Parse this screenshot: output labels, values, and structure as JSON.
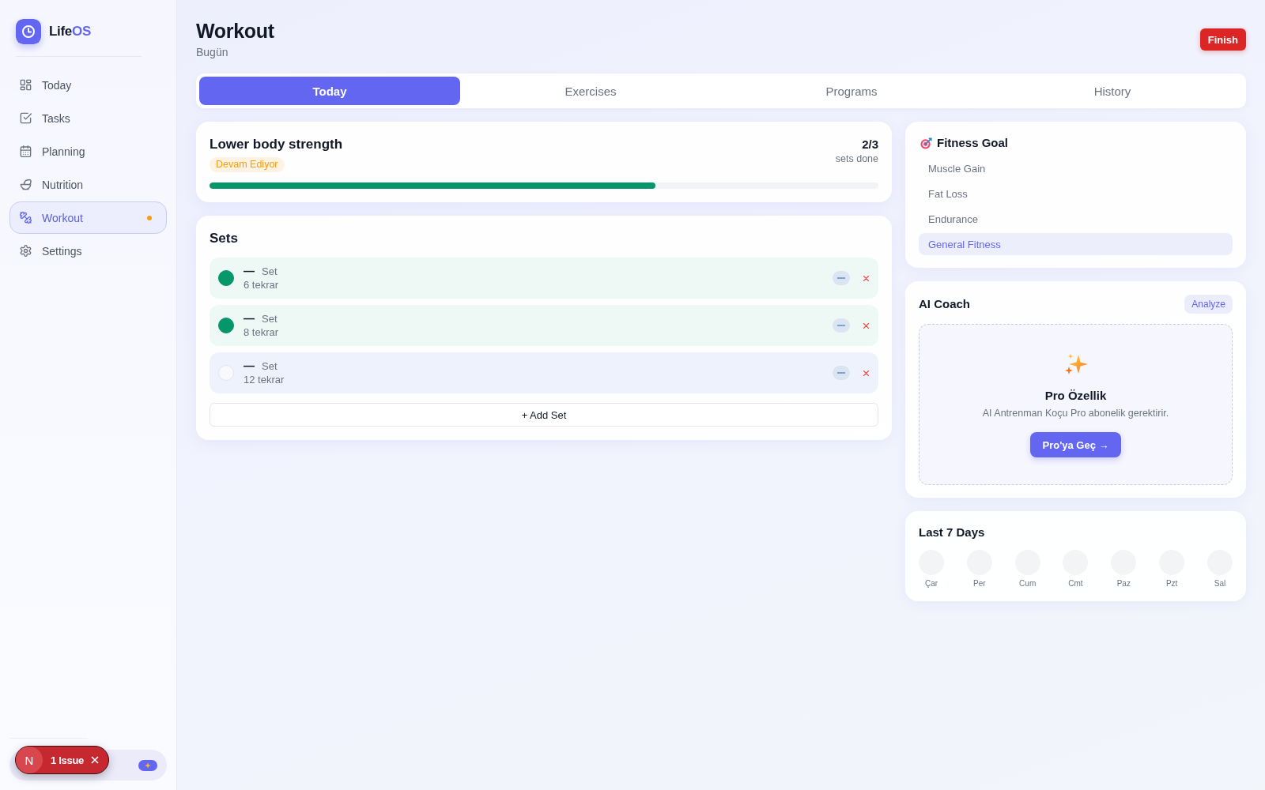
{
  "sidebar": {
    "brand": {
      "name": "Life",
      "accent": "OS"
    },
    "items": [
      {
        "label": "Today",
        "selected": false,
        "dot": false
      },
      {
        "label": "Tasks",
        "selected": false,
        "dot": false
      },
      {
        "label": "Planning",
        "selected": false,
        "dot": false
      },
      {
        "label": "Nutrition",
        "selected": false,
        "dot": false
      },
      {
        "label": "Workout",
        "selected": true,
        "dot": true
      },
      {
        "label": "Settings",
        "selected": false,
        "dot": false
      }
    ]
  },
  "header": {
    "title": "Workout",
    "subtitle": "Bugün",
    "finish_button": "Finish"
  },
  "tabs": [
    {
      "label": "Today",
      "selected": true
    },
    {
      "label": "Exercises",
      "selected": false
    },
    {
      "label": "Programs",
      "selected": false
    },
    {
      "label": "History",
      "selected": false
    }
  ],
  "session": {
    "title": "Lower body strength",
    "status": "Devam Ediyor",
    "count": "2/3",
    "count_label": "sets done",
    "level": 0.667
  },
  "sets": {
    "title": "Sets",
    "rows": [
      {
        "weight": "—",
        "label": "Set",
        "reps": "6 tekrar",
        "done": true
      },
      {
        "weight": "—",
        "label": "Set",
        "reps": "8 tekrar",
        "done": true
      },
      {
        "weight": "—",
        "label": "Set",
        "reps": "12 tekrar",
        "done": false
      }
    ],
    "add_button": "+ Add Set"
  },
  "fitness_goal": {
    "title": "Fitness Goal",
    "options": [
      {
        "label": "Muscle Gain",
        "selected": false
      },
      {
        "label": "Fat Loss",
        "selected": false
      },
      {
        "label": "Endurance",
        "selected": false
      },
      {
        "label": "General Fitness",
        "selected": true
      }
    ]
  },
  "ai_coach": {
    "title": "AI Coach",
    "analyze_button": "Analyze",
    "locked": {
      "title": "Pro Özellik",
      "text": "AI Antrenman Koçu Pro abonelik gerektirir.",
      "button": "Pro'ya Geç →"
    }
  },
  "last_7_days": {
    "title": "Last 7 Days",
    "days": [
      {
        "label": "Çar",
        "done": false
      },
      {
        "label": "Per",
        "done": false
      },
      {
        "label": "Cum",
        "done": false
      },
      {
        "label": "Cmt",
        "done": false
      },
      {
        "label": "Paz",
        "done": false
      },
      {
        "label": "Pzt",
        "done": false
      },
      {
        "label": "Sal",
        "done": false
      }
    ]
  },
  "issues_toast": {
    "avatar": "N",
    "label": "1 Issue"
  }
}
